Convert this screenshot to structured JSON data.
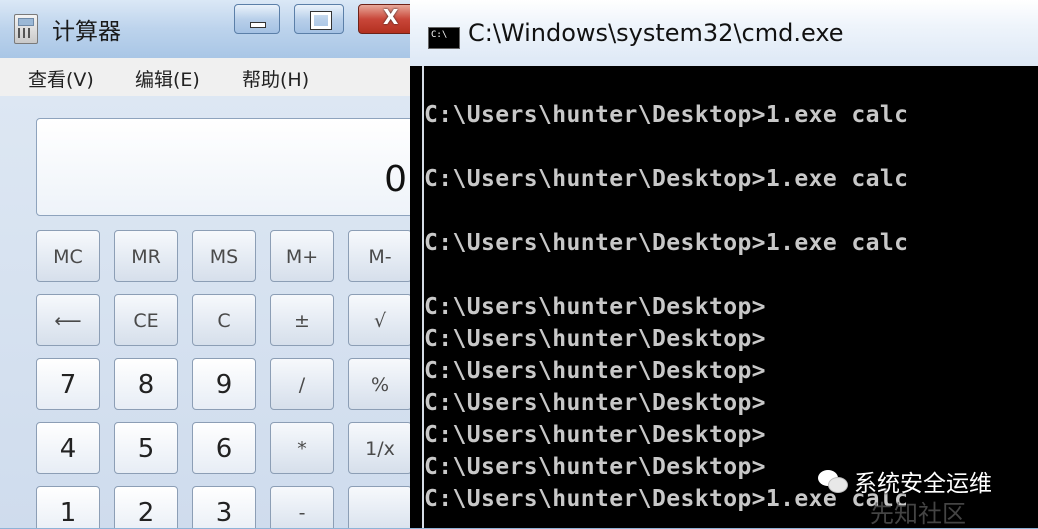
{
  "calculator": {
    "title": "计算器",
    "close_symbol": "X",
    "menu": [
      "查看(V)",
      "编辑(E)",
      "帮助(H)"
    ],
    "display_value": "0",
    "keys": [
      [
        "MC",
        "MR",
        "MS",
        "M+",
        "M-"
      ],
      [
        "⟵",
        "CE",
        "C",
        "±",
        "√"
      ],
      [
        "7",
        "8",
        "9",
        "/",
        "%"
      ],
      [
        "4",
        "5",
        "6",
        "*",
        "1/x"
      ],
      [
        "1",
        "2",
        "3",
        "-",
        ""
      ]
    ]
  },
  "cmd": {
    "title": "C:\\Windows\\system32\\cmd.exe",
    "icon_label": "C:\\",
    "lines": [
      "C:\\Users\\hunter\\Desktop>1.exe calc",
      "C:\\Users\\hunter\\Desktop>1.exe calc",
      "C:\\Users\\hunter\\Desktop>1.exe calc",
      "C:\\Users\\hunter\\Desktop>",
      "C:\\Users\\hunter\\Desktop>",
      "C:\\Users\\hunter\\Desktop>",
      "C:\\Users\\hunter\\Desktop>",
      "C:\\Users\\hunter\\Desktop>",
      "C:\\Users\\hunter\\Desktop>",
      "C:\\Users\\hunter\\Desktop>1.exe calc"
    ]
  },
  "watermark": {
    "text": "系统安全运维",
    "faint_text": "先知社区",
    "icon": "wechat-icon"
  }
}
